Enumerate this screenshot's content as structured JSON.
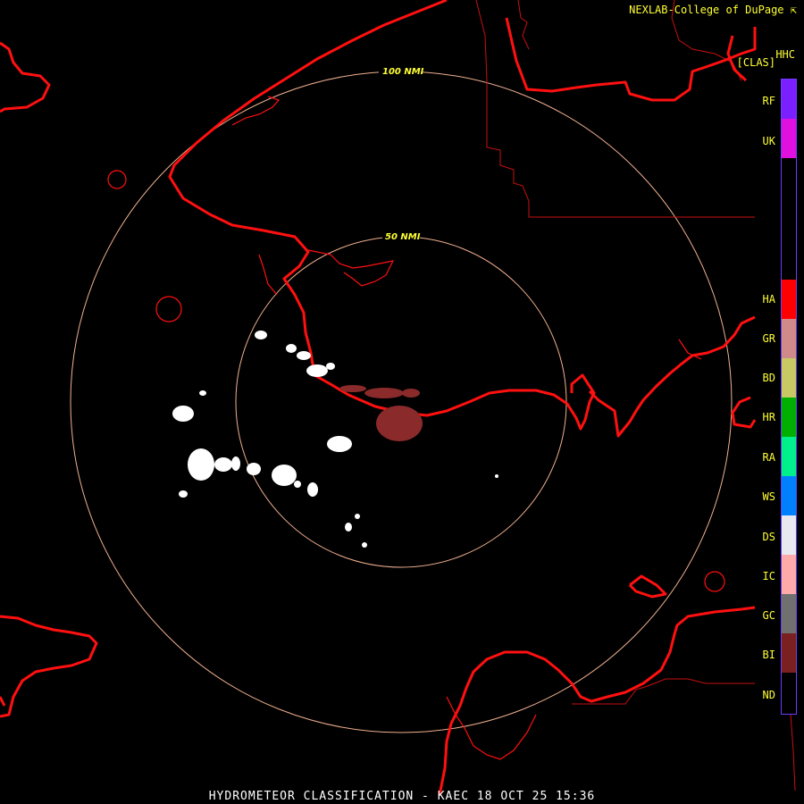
{
  "header": {
    "credit": "NEXLAB-College of DuPage",
    "product_code": "HHC",
    "product_abbrev": "[CLAS]"
  },
  "footer": {
    "caption": "HYDROMETEOR CLASSIFICATION - KAEC 18 OCT 25 15:36"
  },
  "rings": [
    {
      "label": "100 NMI"
    },
    {
      "label": "50 NMI"
    }
  ],
  "legend": [
    {
      "code": "RF",
      "color": "#7a1fff"
    },
    {
      "code": "UK",
      "color": "#e010e0"
    },
    {
      "code": "HA",
      "color": "#ff0000"
    },
    {
      "code": "GR",
      "color": "#d08a8a"
    },
    {
      "code": "BD",
      "color": "#c8c864"
    },
    {
      "code": "HR",
      "color": "#00b000"
    },
    {
      "code": "RA",
      "color": "#00f08c"
    },
    {
      "code": "WS",
      "color": "#0080ff"
    },
    {
      "code": "DS",
      "color": "#e8e8f0"
    },
    {
      "code": "IC",
      "color": "#ffaaaa"
    },
    {
      "code": "GC",
      "color": "#707070"
    },
    {
      "code": "BI",
      "color": "#7a2020"
    },
    {
      "code": "ND",
      "color": "#000000"
    }
  ],
  "colors": {
    "coastline": "#ff1010",
    "boundary": "#c81010",
    "range_ring": "#f0b090",
    "snow_echo": "#ffffff",
    "biological_echo": "#8a2a2a"
  }
}
